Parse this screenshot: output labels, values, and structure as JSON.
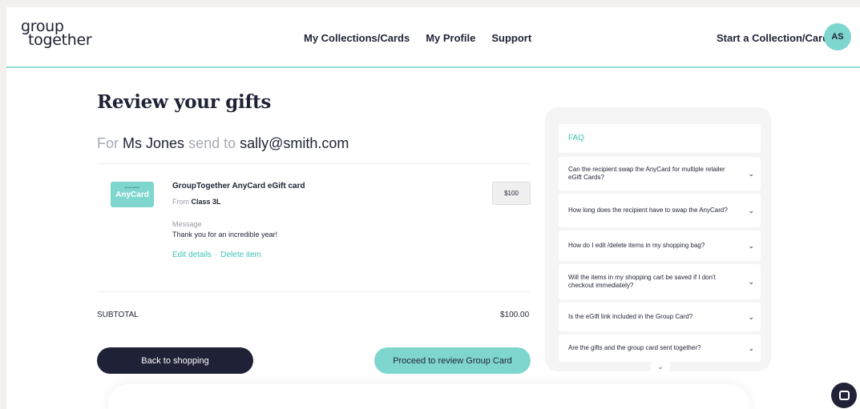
{
  "header": {
    "logo_line1": "group",
    "logo_line2": "together",
    "nav": [
      "My Collections/Cards",
      "My Profile",
      "Support"
    ],
    "start_link": "Start a Collection/Card",
    "avatar_initials": "AS"
  },
  "main": {
    "title": "Review your gifts",
    "for_label": "For",
    "recipient_name": "Ms Jones",
    "send_label": "send to",
    "recipient_email": "sally@smith.com",
    "item": {
      "thumb_tiny": "grouptogether",
      "thumb_name": "AnyCard",
      "title": "GroupTogether AnyCard eGift card",
      "from_label": "From",
      "from_value": "Class 3L",
      "message_label": "Message",
      "message_text": "Thank you for an incredible year!",
      "edit_label": "Edit details",
      "separator": "·",
      "delete_label": "Delete item",
      "price": "$100"
    },
    "subtotal_label": "SUBTOTAL",
    "subtotal_value": "$100.00",
    "back_button": "Back to shopping",
    "proceed_button": "Proceed to review Group Card"
  },
  "faq": {
    "title": "FAQ",
    "items": [
      "Can the recipient swap the AnyCard for multiple retailer eGift Cards?",
      "How long does the recipient have to swap the AnyCard?",
      "How do I edit /delete items in my shopping bag?",
      "Will the items in my shopping cart be saved if I don't checkout immediately?",
      "Is the eGift link included in the Group Card?",
      "Are the gifts and the group card sent together?"
    ]
  },
  "icons": {
    "chevron": "chevron-down-icon",
    "chat": "chat-icon"
  },
  "colors": {
    "accent": "#7fd6cf",
    "link": "#3cc3b8",
    "dark": "#1f2236"
  }
}
